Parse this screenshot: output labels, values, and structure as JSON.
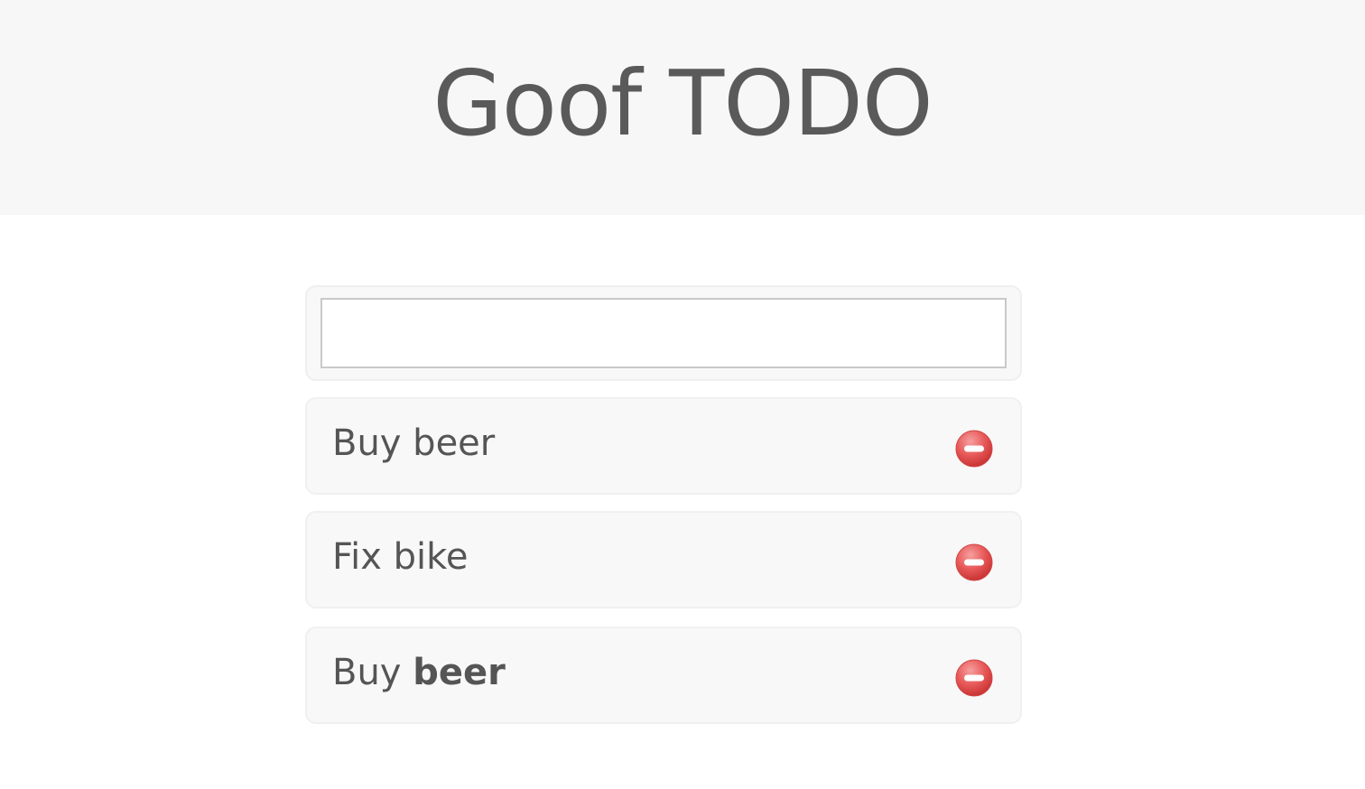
{
  "header": {
    "title": "Goof TODO"
  },
  "new_todo": {
    "value": "",
    "placeholder": ""
  },
  "todos": [
    {
      "prefix": "Buy beer",
      "bold": ""
    },
    {
      "prefix": "Fix bike",
      "bold": ""
    },
    {
      "prefix": "Buy ",
      "bold": "beer"
    }
  ],
  "colors": {
    "header_bg": "#f7f7f7",
    "card_bg": "#f8f8f8",
    "text": "#555555",
    "remove_red": "#e24b4b"
  },
  "icons": {
    "remove": "minus-circle-icon"
  }
}
